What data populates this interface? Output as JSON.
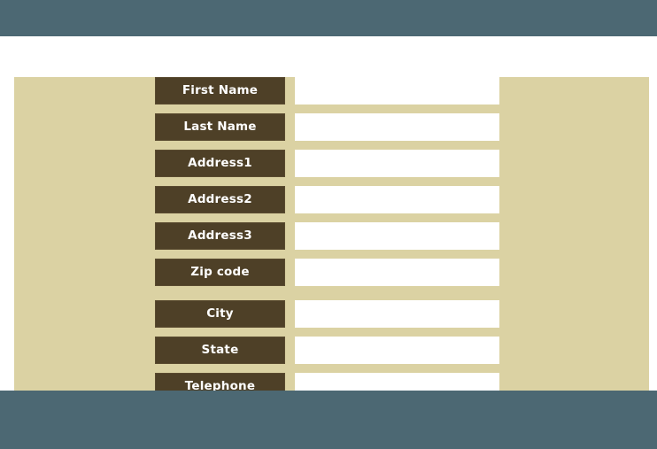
{
  "palette": {
    "page_backdrop": "#4c6873",
    "document_frame": "#ffffff",
    "form_panel": "#dbd2a3",
    "label_background": "#4e4027",
    "label_border": "#5a4b30",
    "label_text": "#ffffff",
    "input_background": "#ffffff",
    "input_text": "#333333"
  },
  "form": {
    "title": "",
    "rows": [
      {
        "label": "First Name",
        "value": "",
        "placeholder": "",
        "group_break": false
      },
      {
        "label": "Last Name",
        "value": "",
        "placeholder": "",
        "group_break": false
      },
      {
        "label": "Address1",
        "value": "",
        "placeholder": "",
        "group_break": false
      },
      {
        "label": "Address2",
        "value": "",
        "placeholder": "",
        "group_break": false
      },
      {
        "label": "Address3",
        "value": "",
        "placeholder": "",
        "group_break": false
      },
      {
        "label": "Zip code",
        "value": "",
        "placeholder": "",
        "group_break": true
      },
      {
        "label": "City",
        "value": "",
        "placeholder": "",
        "group_break": false
      },
      {
        "label": "State",
        "value": "",
        "placeholder": "",
        "group_break": false
      },
      {
        "label": "Telephone",
        "value": "",
        "placeholder": "",
        "group_break": false
      },
      {
        "label": "",
        "value": "",
        "placeholder": "",
        "group_break": false
      }
    ]
  }
}
